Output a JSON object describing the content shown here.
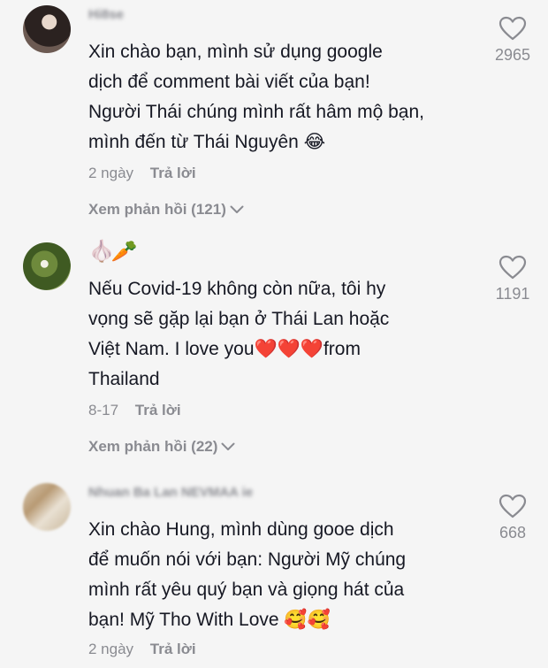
{
  "comments": [
    {
      "username": "Hi8se",
      "lines": [
        "Xin chào bạn, mình sử dụng google",
        "dịch để comment bài viết của bạn!",
        "Người Thái chúng mình rất hâm mộ bạn,",
        "mình đến từ Thái Nguyên 😂"
      ],
      "date": "2 ngày",
      "reply_label": "Trả lời",
      "view_replies": "Xem phản hồi (121)",
      "likes": "2965"
    },
    {
      "username": "🧄🥕",
      "lines": [
        "Nếu Covid-19 không còn nữa, tôi hy",
        "vọng sẽ gặp lại bạn ở Thái Lan hoặc",
        "Việt Nam. I love you❤️❤️❤️from",
        "Thailand"
      ],
      "date": "8-17",
      "reply_label": "Trả lời",
      "view_replies": "Xem phản hồi (22)",
      "likes": "1191"
    },
    {
      "username": "Nhuan Ba Lan NEVMAA ie",
      "lines": [
        "Xin chào Hung, mình dùng gooe dịch",
        "để muốn nói với bạn: Người Mỹ chúng",
        "mình rất yêu quý bạn và giọng hát của",
        "bạn! Mỹ Tho With Love 🥰🥰"
      ],
      "date": "2 ngày",
      "reply_label": "Trả lời",
      "likes": "668"
    }
  ],
  "icons": {
    "like": "heart-outline-icon",
    "expand": "chevron-down-icon"
  },
  "colors": {
    "background": "#f5f5f5",
    "text": "#161823",
    "muted": "#8a8b91"
  }
}
